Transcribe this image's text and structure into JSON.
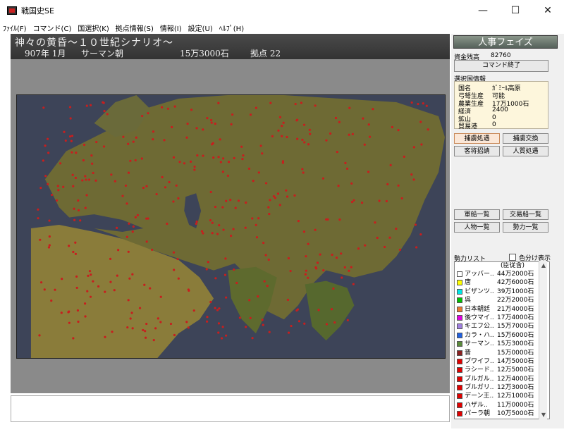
{
  "window": {
    "title": "戦国史SE",
    "controls": {
      "minimize": "—",
      "maximize": "☐",
      "close": "✕"
    }
  },
  "menu": [
    "ﾌｧｲﾙ(F)",
    "コマンド(C)",
    "国選択(K)",
    "拠点情報(S)",
    "情報(I)",
    "設定(U)",
    "ﾍﾙﾌﾟ(H)"
  ],
  "header": {
    "scenario": "神々の黄昏～１０世紀シナリオ～",
    "year_month": "907年  1月",
    "dynasty": "サーマン朝",
    "koku": "15万3000石",
    "bases": "拠点 22"
  },
  "side": {
    "phase": "人事フェイズ",
    "funds_label": "資金残高",
    "funds_value": "82760",
    "end_button": "コマンド終了",
    "info_title": "選択国情報",
    "info": [
      {
        "label": "国名",
        "value": "ｶﾞﾐｰﾙ高原"
      },
      {
        "label": "弓弩生産",
        "value": "可能"
      },
      {
        "label": "農業生産",
        "value": "17万1000石"
      },
      {
        "label": "経済",
        "value": "2400"
      },
      {
        "label": "鉱山",
        "value": "0"
      },
      {
        "label": "貿易港",
        "value": "0"
      }
    ],
    "buttons_top": [
      "捕虜処遇",
      "捕虜交換",
      "客将招請",
      "人質処遇"
    ],
    "buttons_mid": [
      "軍船一覧",
      "交易船一覧",
      "人物一覧",
      "勢力一覧"
    ],
    "list_title": "勢力リスト",
    "color_toggle_label": "色分け表示",
    "list_header": "(臣従含)",
    "factions": [
      {
        "name": "アッバー..",
        "koku": "44万2000石",
        "color": "#ffffff"
      },
      {
        "name": "唐",
        "koku": "42万6000石",
        "color": "#ffff00"
      },
      {
        "name": "ビザンツ..",
        "koku": "39万1000石",
        "color": "#00e5e5"
      },
      {
        "name": "呉",
        "koku": "22万2000石",
        "color": "#00c000"
      },
      {
        "name": "日本朝廷",
        "koku": "21万4000石",
        "color": "#e87830"
      },
      {
        "name": "後ウマイ..",
        "koku": "17万4000石",
        "color": "#e000e0"
      },
      {
        "name": "キエフ公..",
        "koku": "15万7000石",
        "color": "#a080e0"
      },
      {
        "name": "カラ・ハ..",
        "koku": "15万6000石",
        "color": "#2060e0"
      },
      {
        "name": "サーマン..",
        "koku": "15万3000石",
        "color": "#5a8a3a"
      },
      {
        "name": "晋",
        "koku": "15万0000石",
        "color": "#8a2020"
      },
      {
        "name": "ブワイフ..",
        "koku": "14万5000石",
        "color": "#e00000"
      },
      {
        "name": "ラシード..",
        "koku": "12万5000石",
        "color": "#e00000"
      },
      {
        "name": "ブルガル..",
        "koku": "12万4000石",
        "color": "#e00000"
      },
      {
        "name": "ブルガリ..",
        "koku": "12万3000石",
        "color": "#e00000"
      },
      {
        "name": "デーン王..",
        "koku": "12万1000石",
        "color": "#e00000"
      },
      {
        "name": "ハザル..",
        "koku": "11万0000石",
        "color": "#e00000"
      },
      {
        "name": "パーラ朝",
        "koku": "10万5000石",
        "color": "#e00000"
      }
    ]
  },
  "colors": {
    "sea": "#3d4458",
    "land": "#6e6a34",
    "desert": "#8a7c3a",
    "base_dot": "#c81e1e"
  }
}
